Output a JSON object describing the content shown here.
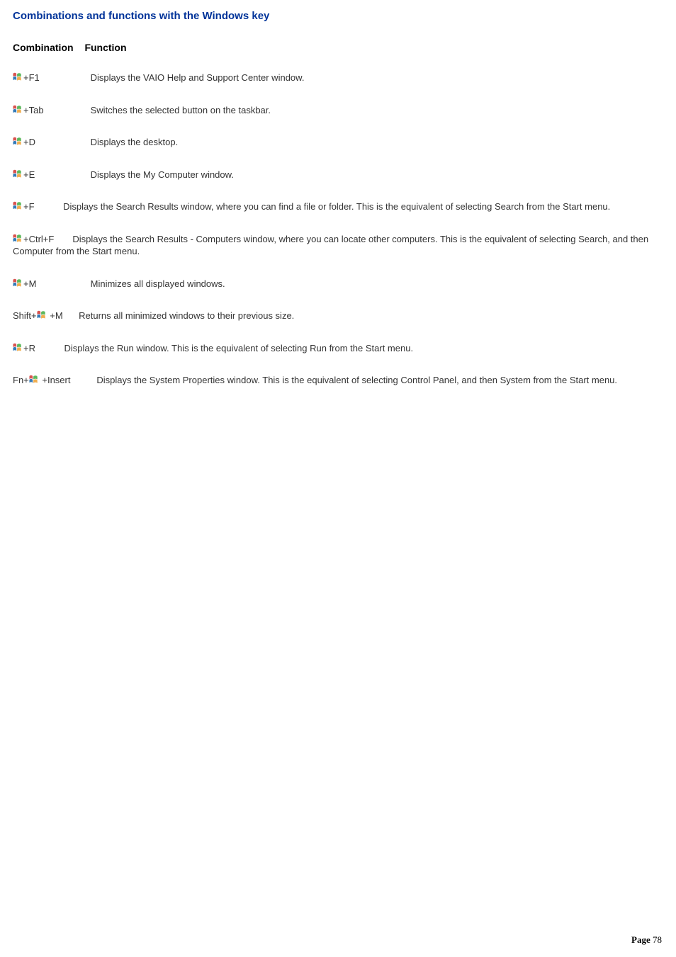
{
  "title": "Combinations and functions with the Windows key",
  "header": {
    "col1": "Combination",
    "col2": "Function"
  },
  "rows": [
    {
      "prefix": "",
      "keys": "+F1",
      "func": "Displays the VAIO Help and Support Center window.",
      "coltype": "col"
    },
    {
      "prefix": "",
      "keys": "+Tab",
      "func": "Switches the selected button on the taskbar.",
      "coltype": "col"
    },
    {
      "prefix": "",
      "keys": "+D",
      "func": "Displays the desktop.",
      "coltype": "col"
    },
    {
      "prefix": "",
      "keys": "+E",
      "func": "Displays the My Computer window.",
      "coltype": "col"
    },
    {
      "prefix": "",
      "keys": "+F",
      "func": "Displays the Search Results window, where you can find a file or folder. This is the equivalent of selecting Search from the Start menu.",
      "coltype": "nocol"
    },
    {
      "prefix": "",
      "keys": "+Ctrl+F",
      "func": "Displays the Search Results - Computers window, where you can locate other computers. This is the equivalent of selecting Search, and then Computer from the Start menu.",
      "coltype": "nocol"
    },
    {
      "prefix": "",
      "keys": "+M",
      "func": "Minimizes all displayed windows.",
      "coltype": "col"
    },
    {
      "prefix": "Shift+",
      "keys": " +M",
      "func": "Returns all minimized windows to their previous size.",
      "coltype": "nocol"
    },
    {
      "prefix": "",
      "keys": "+R",
      "func": "Displays the Run window. This is the equivalent of selecting Run from the Start menu.",
      "coltype": "nocol"
    },
    {
      "prefix": "Fn+",
      "keys": " +Insert",
      "func": "Displays the System Properties window. This is the equivalent of selecting Control Panel, and then System from the Start menu.",
      "coltype": "nocol"
    }
  ],
  "footer": {
    "label": "Page",
    "number": "78"
  }
}
